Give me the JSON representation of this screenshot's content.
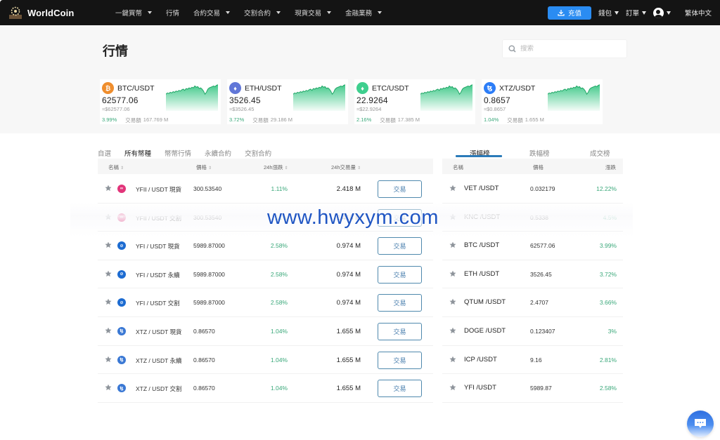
{
  "header": {
    "brand": "WorldCoin",
    "nav": [
      {
        "label": "一鍵買幣",
        "dropdown": true
      },
      {
        "label": "行情",
        "dropdown": false
      },
      {
        "label": "合約交易",
        "dropdown": true
      },
      {
        "label": "交割合約",
        "dropdown": true
      },
      {
        "label": "現貨交易",
        "dropdown": true
      },
      {
        "label": "金融業務",
        "dropdown": true
      }
    ],
    "deposit_label": "充值",
    "wallet_label": "錢包",
    "orders_label": "訂單",
    "language": "繁体中文"
  },
  "page": {
    "title": "行情",
    "search_placeholder": "搜索"
  },
  "tickers": [
    {
      "pair": "BTC/USDT",
      "price": "62577.06",
      "fiat": "≈$62577.06",
      "change": "3.99%",
      "volume_label": "交易額",
      "volume": "167.769 M",
      "icon": "bitcoin-icon",
      "color": "#ef8e2e",
      "glyph": "₿"
    },
    {
      "pair": "ETH/USDT",
      "price": "3526.45",
      "fiat": "≈$3526.45",
      "change": "3.72%",
      "volume_label": "交易額",
      "volume": "29.186 M",
      "icon": "ethereum-icon",
      "color": "#6177d8",
      "glyph": "♦"
    },
    {
      "pair": "ETC/USDT",
      "price": "22.9264",
      "fiat": "≈$22.9264",
      "change": "2.16%",
      "volume_label": "交易額",
      "volume": "17.385 M",
      "icon": "ethereum-classic-icon",
      "color": "#3ecf8e",
      "glyph": "♦"
    },
    {
      "pair": "XTZ/USDT",
      "price": "0.8657",
      "fiat": "≈$0.8657",
      "change": "1.04%",
      "volume_label": "交易額",
      "volume": "1.655 M",
      "icon": "tezos-icon",
      "color": "#2c7df7",
      "glyph": "ꜩ"
    }
  ],
  "market": {
    "tabs": [
      {
        "label": "自選",
        "active": false
      },
      {
        "label": "所有幣種",
        "active": true
      },
      {
        "label": "幣幣行情",
        "active": false
      },
      {
        "label": "永續合約",
        "active": false
      },
      {
        "label": "交割合約",
        "active": false
      }
    ],
    "columns": {
      "name": "名稱",
      "price": "價格",
      "change": "24h漲跌",
      "volume": "24h交易量"
    },
    "trade_label": "交易",
    "rows": [
      {
        "name": "YFII / USDT 現貨",
        "price": "300.53540",
        "change": "1.11%",
        "volume": "2.418 M",
        "icon": "yfii-icon",
        "color": "#e2357a",
        "glyph": "∞"
      },
      {
        "name": "YFII / USDT 交割",
        "price": "300.53540",
        "change": "1.11%",
        "volume": "2.418 M",
        "icon": "yfii-icon",
        "color": "#e2357a",
        "glyph": "∞"
      },
      {
        "name": "YFI / USDT 現貨",
        "price": "5989.87000",
        "change": "2.58%",
        "volume": "0.974 M",
        "icon": "yfi-icon",
        "color": "#1c6bd1",
        "glyph": "⊘"
      },
      {
        "name": "YFI / USDT 永續",
        "price": "5989.87000",
        "change": "2.58%",
        "volume": "0.974 M",
        "icon": "yfi-icon",
        "color": "#1c6bd1",
        "glyph": "⊘"
      },
      {
        "name": "YFI / USDT 交割",
        "price": "5989.87000",
        "change": "2.58%",
        "volume": "0.974 M",
        "icon": "yfi-icon",
        "color": "#1c6bd1",
        "glyph": "⊘"
      },
      {
        "name": "XTZ / USDT 現貨",
        "price": "0.86570",
        "change": "1.04%",
        "volume": "1.655 M",
        "icon": "tezos-icon",
        "color": "#3a78d4",
        "glyph": "ꜩ"
      },
      {
        "name": "XTZ / USDT 永續",
        "price": "0.86570",
        "change": "1.04%",
        "volume": "1.655 M",
        "icon": "tezos-icon",
        "color": "#3a78d4",
        "glyph": "ꜩ"
      },
      {
        "name": "XTZ / USDT 交割",
        "price": "0.86570",
        "change": "1.04%",
        "volume": "1.655 M",
        "icon": "tezos-icon",
        "color": "#3a78d4",
        "glyph": "ꜩ"
      }
    ]
  },
  "ranking": {
    "tabs": [
      {
        "label": "漲幅榜",
        "active": true
      },
      {
        "label": "跌幅榜",
        "active": false
      },
      {
        "label": "成交榜",
        "active": false
      }
    ],
    "columns": {
      "name": "名稱",
      "price": "價格",
      "change": "漲跌"
    },
    "rows": [
      {
        "pair": "VET /USDT",
        "price": "0.032179",
        "change": "12.22%"
      },
      {
        "pair": "KNC /USDT",
        "price": "0.5338",
        "change": "4.5%"
      },
      {
        "pair": "BTC /USDT",
        "price": "62577.06",
        "change": "3.99%"
      },
      {
        "pair": "ETH /USDT",
        "price": "3526.45",
        "change": "3.72%"
      },
      {
        "pair": "QTUM /USDT",
        "price": "2.4707",
        "change": "3.66%"
      },
      {
        "pair": "DOGE /USDT",
        "price": "0.123407",
        "change": "3%"
      },
      {
        "pair": "ICP /USDT",
        "price": "9.16",
        "change": "2.81%"
      },
      {
        "pair": "YFI /USDT",
        "price": "5989.87",
        "change": "2.58%"
      }
    ]
  },
  "watermark": "www.hwyxym.com",
  "colors": {
    "accent": "#2a8cf2",
    "up": "#3aa87a",
    "trade_border": "#4f89ad",
    "topbar": "#141414"
  }
}
